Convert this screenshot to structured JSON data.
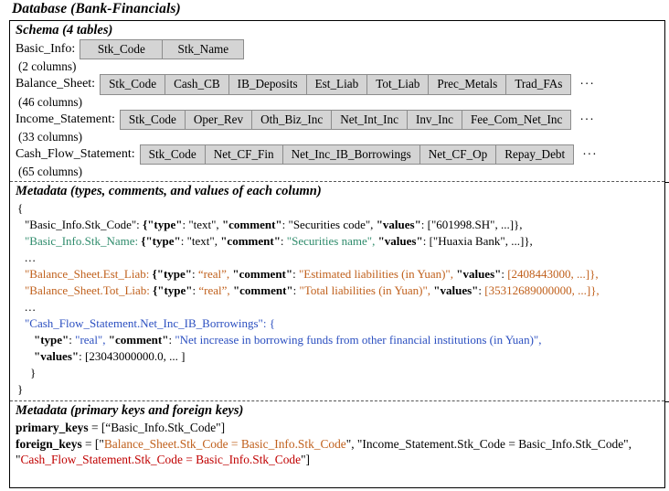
{
  "title": "Database (Bank-Financials)",
  "schema": {
    "heading": "Schema (4 tables)",
    "ellipsis": "···",
    "tables": [
      {
        "name": "Basic_Info:",
        "columns": [
          "Stk_Code",
          "Stk_Name"
        ],
        "count_label": "(2 columns)",
        "has_ellipsis": false
      },
      {
        "name": "Balance_Sheet:",
        "columns": [
          "Stk_Code",
          "Cash_CB",
          "IB_Deposits",
          "Est_Liab",
          "Tot_Liab",
          "Prec_Metals",
          "Trad_FAs"
        ],
        "count_label": "(46 columns)",
        "has_ellipsis": true
      },
      {
        "name": "Income_Statement:",
        "columns": [
          "Stk_Code",
          "Oper_Rev",
          "Oth_Biz_Inc",
          "Net_Int_Inc",
          "Inv_Inc",
          "Fee_Com_Net_Inc"
        ],
        "count_label": "(33 columns)",
        "has_ellipsis": true
      },
      {
        "name": "Cash_Flow_Statement:",
        "columns": [
          "Stk_Code",
          "Net_CF_Fin",
          "Net_Inc_IB_Borrowings",
          "Net_CF_Op",
          "Repay_Debt"
        ],
        "count_label": "(65 columns)",
        "has_ellipsis": true
      }
    ]
  },
  "metadata": {
    "heading": "Metadata (types, comments, and values of each column)",
    "open_brace": "{",
    "close_brace": "}",
    "ellipsis_line": "...",
    "key_type": "\"type\"",
    "key_comment": "\"comment\"",
    "key_values": "\"values\"",
    "entries": {
      "stk_code": {
        "key": "\"Basic_Info.Stk_Code\":",
        "open": "{",
        "type": "\"text\",",
        "comment": "\"Securities code\",",
        "values": "[\"601998.SH\", ...]},"
      },
      "stk_name": {
        "key": "\"Basic_Info.Stk_Name:",
        "open": "{",
        "type": "\"text\",",
        "comment": "\"Securities name\",",
        "values": "[\"Huaxia Bank\", ...]},"
      },
      "est_liab": {
        "key": "\"Balance_Sheet.Est_Liab:",
        "open": "{",
        "type": "“real”,",
        "comment": "\"Estimated liabilities (in Yuan)\",",
        "values": "[2408443000, ...]},"
      },
      "tot_liab": {
        "key": "\"Balance_Sheet.Tot_Liab:",
        "open": "{",
        "type": "“real”,",
        "comment": "\"Total liabilities (in Yuan)\",",
        "values": "[35312689000000, ...]},"
      },
      "net_inc_ib": {
        "key": "\"Cash_Flow_Statement.Net_Inc_IB_Borrowings\": {",
        "type": "\"real\",",
        "comment": "\"Net increase in borrowing funds from other financial institutions (in Yuan)\",",
        "values": "[23043000000.0, ... ]",
        "close": "}"
      }
    }
  },
  "keys": {
    "heading": "Metadata (primary keys and foreign keys)",
    "primary_label": "primary_keys",
    "primary_eq": " = [“Basic_Info.Stk_Code\"]",
    "foreign_label": "foreign_keys",
    "foreign_open": " = [\"",
    "foreign_1": "Balance_Sheet.Stk_Code = Basic_Info.Stk_Code",
    "foreign_sep1": "\", \"",
    "foreign_2": "Income_Statement.Stk_Code = Basic_Info.Stk_Code",
    "foreign_sep2": "\", \"",
    "foreign_3": "Cash_Flow_Statement.Stk_Code = Basic_Info.Stk_Code",
    "foreign_close": "\"]"
  },
  "colors": {
    "chip_bg": "#d4d4d4",
    "green": "#2e8b6b",
    "orange": "#c0601c",
    "blue": "#2b4fc0",
    "red": "#c00000"
  }
}
